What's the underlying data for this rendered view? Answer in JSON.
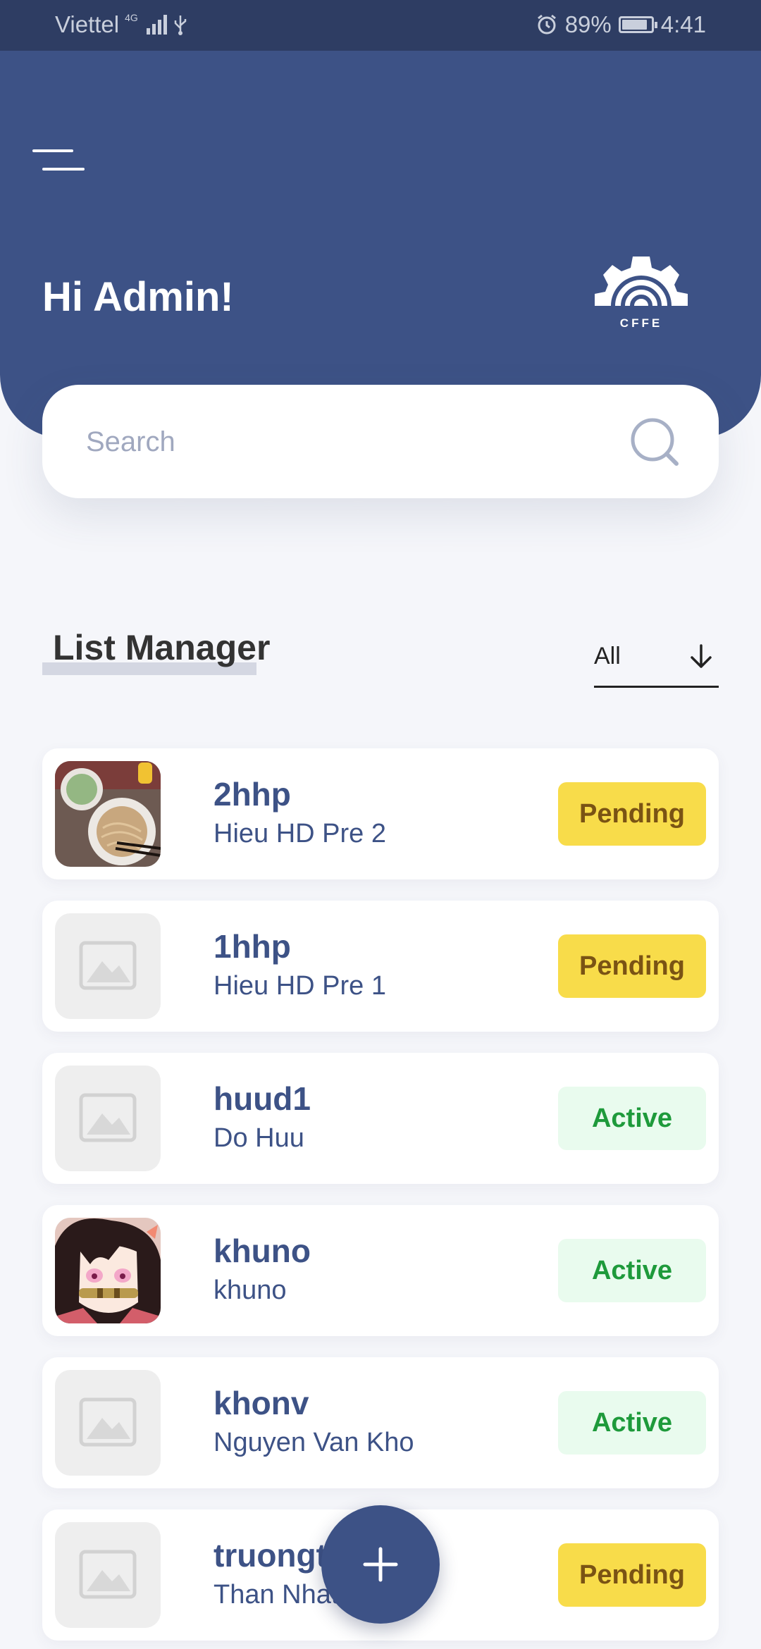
{
  "status_bar": {
    "carrier": "Viettel",
    "network": "4G",
    "battery_percent": "89%",
    "battery_level": 0.89,
    "time": "4:41"
  },
  "header": {
    "greeting": "Hi Admin!",
    "logo_text": "CFFE"
  },
  "search": {
    "placeholder": "Search",
    "value": ""
  },
  "section": {
    "title": "List Manager",
    "filter_value": "All"
  },
  "list": [
    {
      "username": "2hhp",
      "fullname": "Hieu HD Pre 2",
      "status": "Pending",
      "avatar": "food-photo"
    },
    {
      "username": "1hhp",
      "fullname": "Hieu HD Pre 1",
      "status": "Pending",
      "avatar": "placeholder"
    },
    {
      "username": "huud1",
      "fullname": "Do Huu",
      "status": "Active",
      "avatar": "placeholder"
    },
    {
      "username": "khuno",
      "fullname": "khuno",
      "status": "Active",
      "avatar": "anime-photo"
    },
    {
      "username": "khonv",
      "fullname": "Nguyen Van Kho",
      "status": "Active",
      "avatar": "placeholder"
    },
    {
      "username": "truongt",
      "fullname": "Than Nhat",
      "status": "Pending",
      "avatar": "placeholder"
    }
  ],
  "colors": {
    "primary": "#3d5286",
    "pending_bg": "#f8dc4a",
    "pending_text": "#7a5314",
    "active_bg": "#e9fbee",
    "active_text": "#1e9a3b"
  },
  "icons": {
    "menu": "menu-icon",
    "search": "search-icon",
    "filter": "arrow-down-icon",
    "add": "plus-icon",
    "placeholder": "image-placeholder-icon"
  }
}
